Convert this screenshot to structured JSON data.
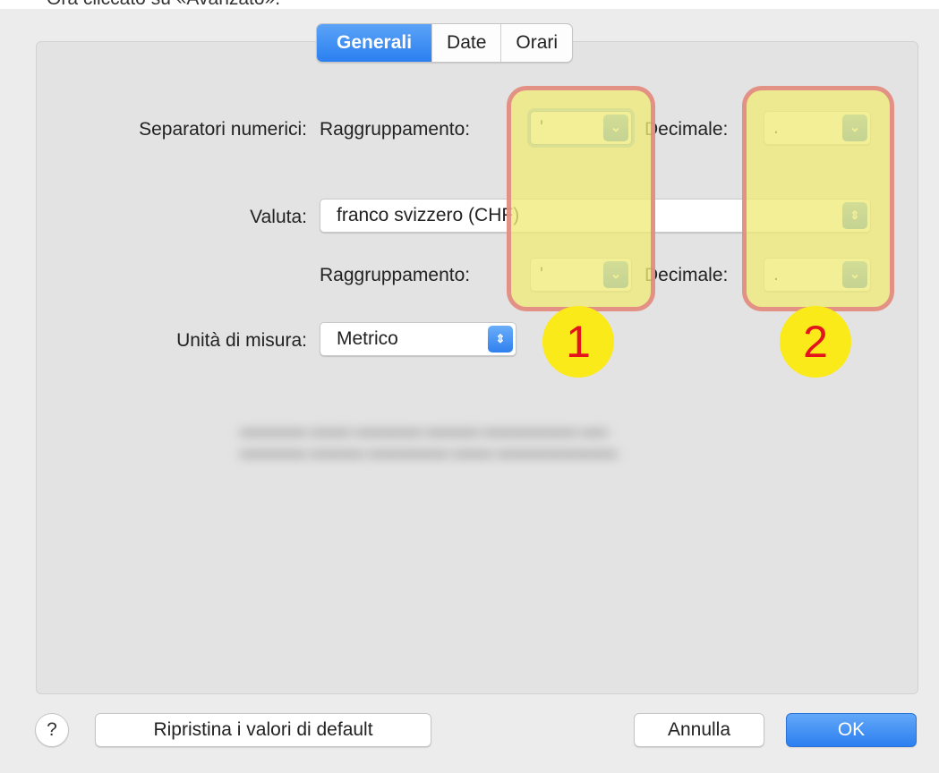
{
  "caption": "Ora cliccato su «Avanzato».",
  "tabs": [
    {
      "label": "Generali",
      "active": true
    },
    {
      "label": "Date",
      "active": false
    },
    {
      "label": "Orari",
      "active": false
    }
  ],
  "numeric_separators": {
    "label": "Separatori numerici:",
    "grouping_label": "Raggruppamento:",
    "grouping_value": "'",
    "decimal_label": "Decimale:",
    "decimal_value": "."
  },
  "currency": {
    "label": "Valuta:",
    "value": "franco svizzero (CHF)",
    "grouping_label": "Raggruppamento:",
    "grouping_value": "'",
    "decimal_label": "Decimale:",
    "decimal_value": "."
  },
  "units": {
    "label": "Unità di misura:",
    "value": "Metrico"
  },
  "annotations": {
    "badge_1": "1",
    "badge_2": "2"
  },
  "buttons": {
    "help": "?",
    "restore": "Ripristina i valori di default",
    "cancel": "Annulla",
    "ok": "OK"
  },
  "icons": {
    "popup_chevron": "chevron-down-icon",
    "stepper": "up-down-chevron-icon"
  },
  "colors": {
    "accent": "#2a7ff0",
    "highlight_fill": "#f0ea78",
    "highlight_border": "#e28282",
    "badge_fill": "#fbea19",
    "badge_text": "#e3141c"
  }
}
